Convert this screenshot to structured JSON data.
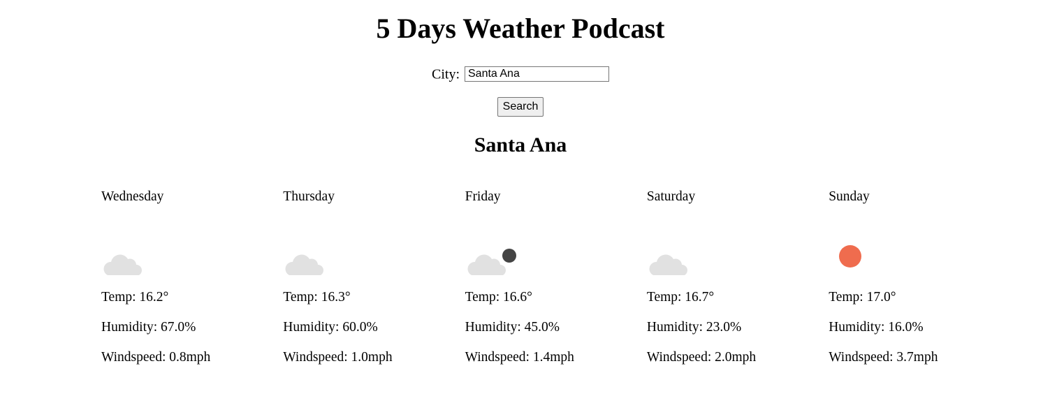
{
  "app": {
    "title": "5 Days Weather Podcast"
  },
  "search": {
    "city_label": "City:",
    "city_value": "Santa Ana",
    "button_label": "Search"
  },
  "result": {
    "city": "Santa Ana"
  },
  "days": [
    {
      "name": "Wednesday",
      "icon": "cloud-icon",
      "temp": "Temp: 16.2°",
      "humidity": "Humidity: 67.0%",
      "windspeed": "Windspeed: 0.8mph"
    },
    {
      "name": "Thursday",
      "icon": "cloud-icon",
      "temp": "Temp: 16.3°",
      "humidity": "Humidity: 60.0%",
      "windspeed": "Windspeed: 1.0mph"
    },
    {
      "name": "Friday",
      "icon": "partly-cloudy-night-icon",
      "temp": "Temp: 16.6°",
      "humidity": "Humidity: 45.0%",
      "windspeed": "Windspeed: 1.4mph"
    },
    {
      "name": "Saturday",
      "icon": "cloud-icon",
      "temp": "Temp: 16.7°",
      "humidity": "Humidity: 23.0%",
      "windspeed": "Windspeed: 2.0mph"
    },
    {
      "name": "Sunday",
      "icon": "sun-icon",
      "temp": "Temp: 17.0°",
      "humidity": "Humidity: 16.0%",
      "windspeed": "Windspeed: 3.7mph"
    }
  ],
  "colors": {
    "cloud": "#e1e1e1",
    "moon": "#444444",
    "sun": "#ef6c4e"
  }
}
